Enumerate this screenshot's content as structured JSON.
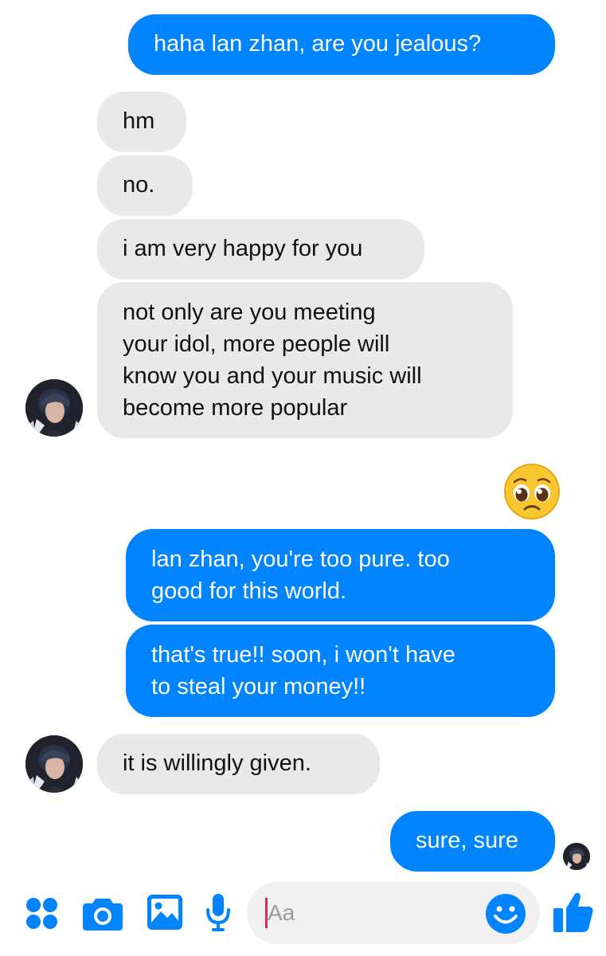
{
  "colors": {
    "outgoing_bubble": "#0084ff",
    "incoming_bubble": "#e9e9e9",
    "accent": "#0084ff",
    "cursor": "#e0245e"
  },
  "messages": [
    {
      "sender": "me",
      "text": "haha lan zhan, are you jealous?"
    },
    {
      "sender": "them",
      "text": "hm"
    },
    {
      "sender": "them",
      "text": "no."
    },
    {
      "sender": "them",
      "text": "i am very happy for you"
    },
    {
      "sender": "them",
      "lines": [
        "not only are you meeting",
        "your idol, more people will",
        "know you and your music will",
        "become more popular"
      ]
    },
    {
      "sender": "me",
      "emoji": "pleading-face-emoji"
    },
    {
      "sender": "me",
      "lines": [
        "lan zhan, you're too pure. too",
        "good for this world."
      ]
    },
    {
      "sender": "me",
      "lines": [
        "that's true!! soon, i won't have",
        "to steal your money!!"
      ]
    },
    {
      "sender": "them",
      "text": "it is willingly given."
    },
    {
      "sender": "me",
      "text": "sure, sure"
    }
  ],
  "composer": {
    "placeholder": "Aa",
    "icons": [
      "more-apps-icon",
      "camera-icon",
      "gallery-icon",
      "microphone-icon",
      "emoji-icon",
      "thumbs-up-icon"
    ]
  }
}
